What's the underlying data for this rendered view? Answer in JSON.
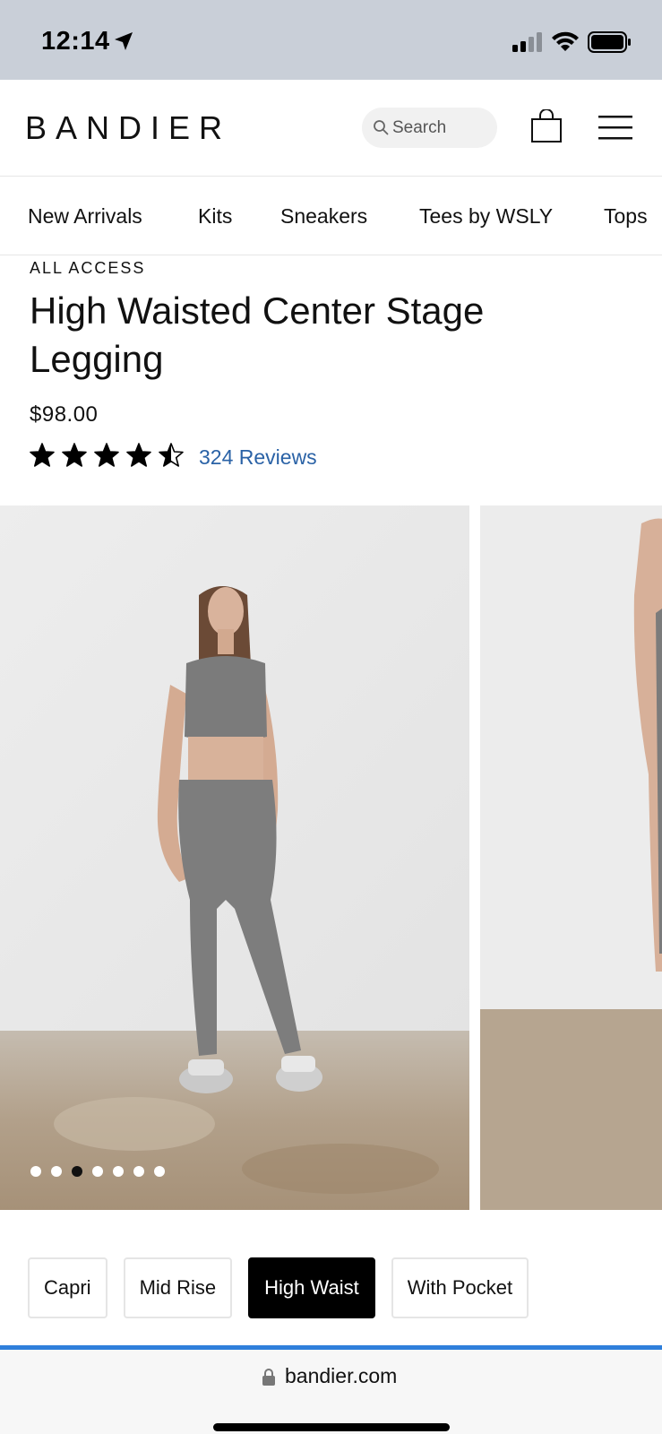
{
  "status_bar": {
    "time": "12:14",
    "icons": [
      "location-arrow-icon",
      "signal-icon",
      "wifi-icon",
      "battery-icon"
    ]
  },
  "header": {
    "logo": "BANDIER",
    "search_placeholder": "Search",
    "icons": [
      "search-icon",
      "shopping-bag-icon",
      "hamburger-menu-icon"
    ]
  },
  "categories": [
    "New Arrivals",
    "Kits",
    "Sneakers",
    "Tees by WSLY",
    "Tops"
  ],
  "product": {
    "brand": "ALL ACCESS",
    "title": "High Waisted Center Stage Legging",
    "price": "$98.00",
    "rating": 4.5,
    "rating_max": 5,
    "reviews": "324 Reviews",
    "gallery": {
      "image_count": 7,
      "active_index": 2
    }
  },
  "variants": {
    "options": [
      "Capri",
      "Mid Rise",
      "High Waist",
      "With Pocket"
    ],
    "selected": "High Waist"
  },
  "browser": {
    "url": "bandier.com"
  },
  "colors": {
    "accent_link": "#2a62a6",
    "progress": "#2f7fdb",
    "status_bar_bg": "#c9cfd8",
    "product_color": "#7b7b7b"
  }
}
